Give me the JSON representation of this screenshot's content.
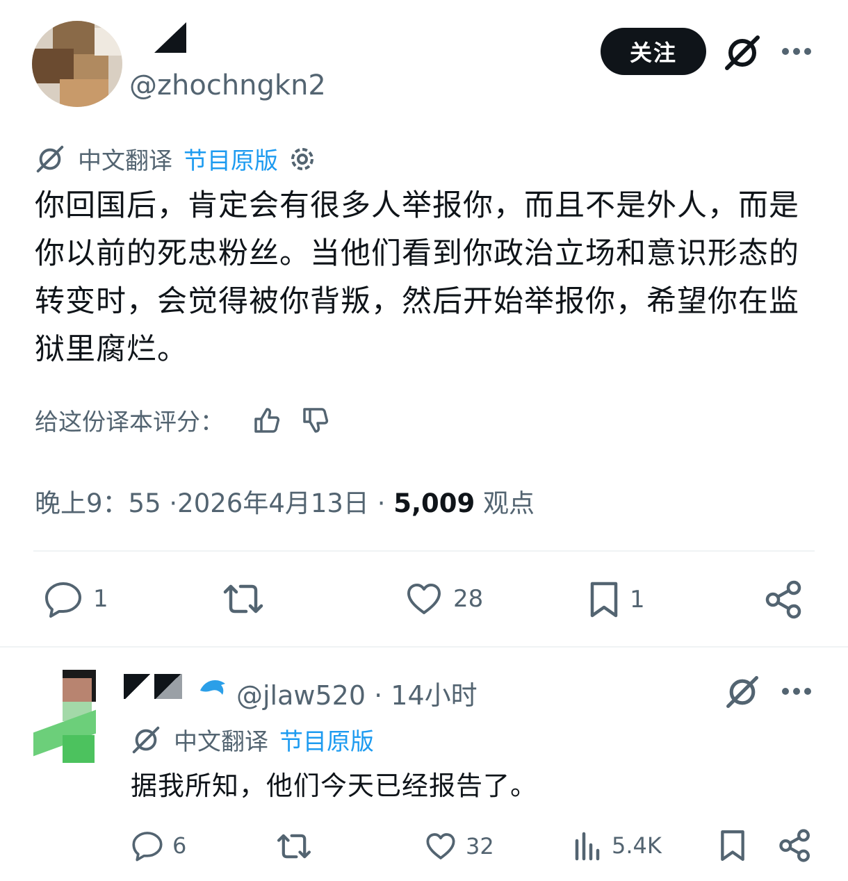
{
  "post": {
    "handle": "@zhochngkn2",
    "follow_label": "关注",
    "translate_label": "中文翻译",
    "original_label": "节目原版",
    "text": "你回国后，肯定会有很多人举报你，而且不是外人，而是你以前的死忠粉丝。当他们看到你政治立场和意识形态的转变时，会觉得被你背叛，然后开始举报你，希望你在监狱里腐烂。",
    "rate_label": "给这份译本评分：",
    "time": "晚上9：55",
    "date": "·2026年4月13日",
    "separator": "·",
    "views_count": "5,009",
    "views_label": "观点",
    "actions": {
      "replies": "1",
      "likes": "28",
      "bookmarks": "1"
    }
  },
  "reply": {
    "handle": "@jlaw520",
    "time": "· 14小时",
    "translate_label": "中文翻译",
    "original_label": "节目原版",
    "text": "据我所知，他们今天已经报告了。",
    "actions": {
      "replies": "6",
      "likes": "32",
      "views": "5.4K"
    }
  },
  "colors": {
    "text": "#0f1419",
    "secondary": "#536471",
    "link": "#1d9bf0",
    "divider": "#eff3f4"
  }
}
